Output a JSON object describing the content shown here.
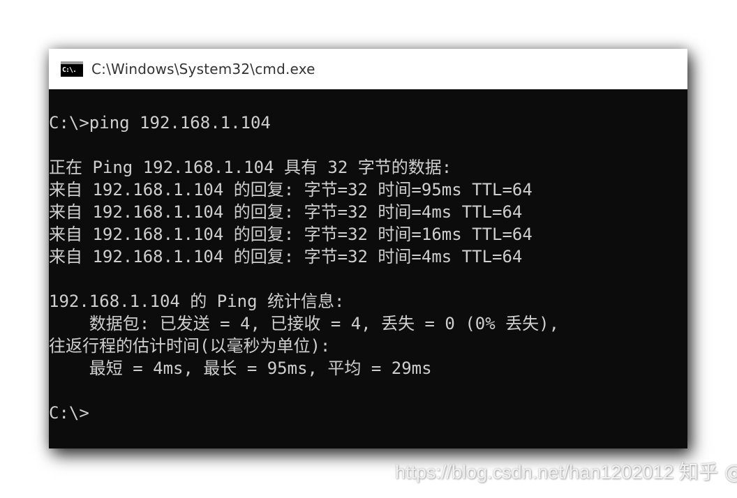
{
  "window": {
    "icon_label": "C:\\.",
    "title": "C:\\Windows\\System32\\cmd.exe"
  },
  "console": {
    "lines": [
      "C:\\>ping 192.168.1.104",
      "",
      "正在 Ping 192.168.1.104 具有 32 字节的数据:",
      "来自 192.168.1.104 的回复: 字节=32 时间=95ms TTL=64",
      "来自 192.168.1.104 的回复: 字节=32 时间=4ms TTL=64",
      "来自 192.168.1.104 的回复: 字节=32 时间=16ms TTL=64",
      "来自 192.168.1.104 的回复: 字节=32 时间=4ms TTL=64",
      "",
      "192.168.1.104 的 Ping 统计信息:",
      "    数据包: 已发送 = 4, 已接收 = 4, 丢失 = 0 (0% 丢失),",
      "往返行程的估计时间(以毫秒为单位):",
      "    最短 = 4ms, 最长 = 95ms, 平均 = 29ms",
      "",
      "C:\\>"
    ]
  },
  "watermark": {
    "url": "https://blog.csdn.net/han1202012",
    "site": "知乎 @现实"
  }
}
